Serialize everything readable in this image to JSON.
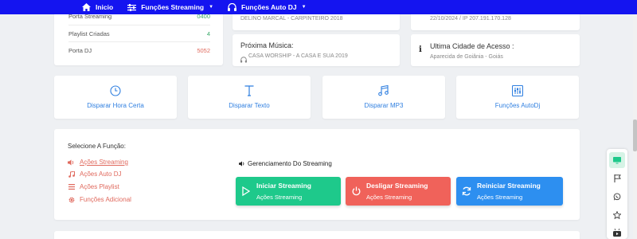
{
  "nav": {
    "items": [
      {
        "label": "Inicio",
        "icon": "home-icon",
        "dropdown": false
      },
      {
        "label": "Funções Streaming",
        "icon": "sliders-icon",
        "dropdown": true
      },
      {
        "label": "Funções Auto DJ",
        "icon": "headphones-icon",
        "dropdown": true
      }
    ]
  },
  "stats": {
    "rows": [
      {
        "label": "Porta Streaming",
        "value": "0400"
      },
      {
        "label": "Playlist Criadas",
        "value": "4",
        "color": "#3aaa6a"
      },
      {
        "label": "Porta DJ",
        "value": "5052",
        "color": "#e06a5e"
      }
    ]
  },
  "now_playing": {
    "current": "DELINO MARCAL - CARPINTEIRO 2018",
    "next_title": "Próxima Música:",
    "next_song": "CASA WORSHIP - A CASA E SUA 2019"
  },
  "access": {
    "last_access": "22/10/2024 / IP 207.191.170.128",
    "city_title": "Ultima Cidade de Acesso :",
    "city": "Aparecida de Goiânia - Goiás"
  },
  "actions": [
    {
      "label": "Disparar Hora Certa",
      "icon": "clock-icon"
    },
    {
      "label": "Disparar Texto",
      "icon": "text-icon"
    },
    {
      "label": "Disparar MP3",
      "icon": "music-note-icon"
    },
    {
      "label": "Funções AutoDj",
      "icon": "equalizer-icon"
    }
  ],
  "functions": {
    "title": "Selecione A Função:",
    "menu": [
      {
        "label": "Ações Streaming",
        "icon": "volume-icon",
        "active": true
      },
      {
        "label": "Ações Auto DJ",
        "icon": "music-icon",
        "active": false
      },
      {
        "label": "Ações Playlist",
        "icon": "list-icon",
        "active": false
      },
      {
        "label": "Funções Adicional",
        "icon": "gear-icon",
        "active": false
      }
    ],
    "panel_title": "Gerenciamento Do Streaming",
    "buttons": [
      {
        "title": "Iniciar Streaming",
        "sub": "Ações Streaming",
        "color": "#1ec98b",
        "icon": "play-icon"
      },
      {
        "title": "Desligar Streaming",
        "sub": "Ações Streaming",
        "color": "#f0625a",
        "icon": "power-icon"
      },
      {
        "title": "Reiniciar Streaming",
        "sub": "Ações Streaming",
        "color": "#2d8ff0",
        "icon": "refresh-icon"
      }
    ]
  },
  "sidebar": {
    "icons": [
      "monitor-icon",
      "flag-icon",
      "whatsapp-icon",
      "star-icon",
      "youtube-icon"
    ],
    "active_color": "#1ec98b"
  }
}
